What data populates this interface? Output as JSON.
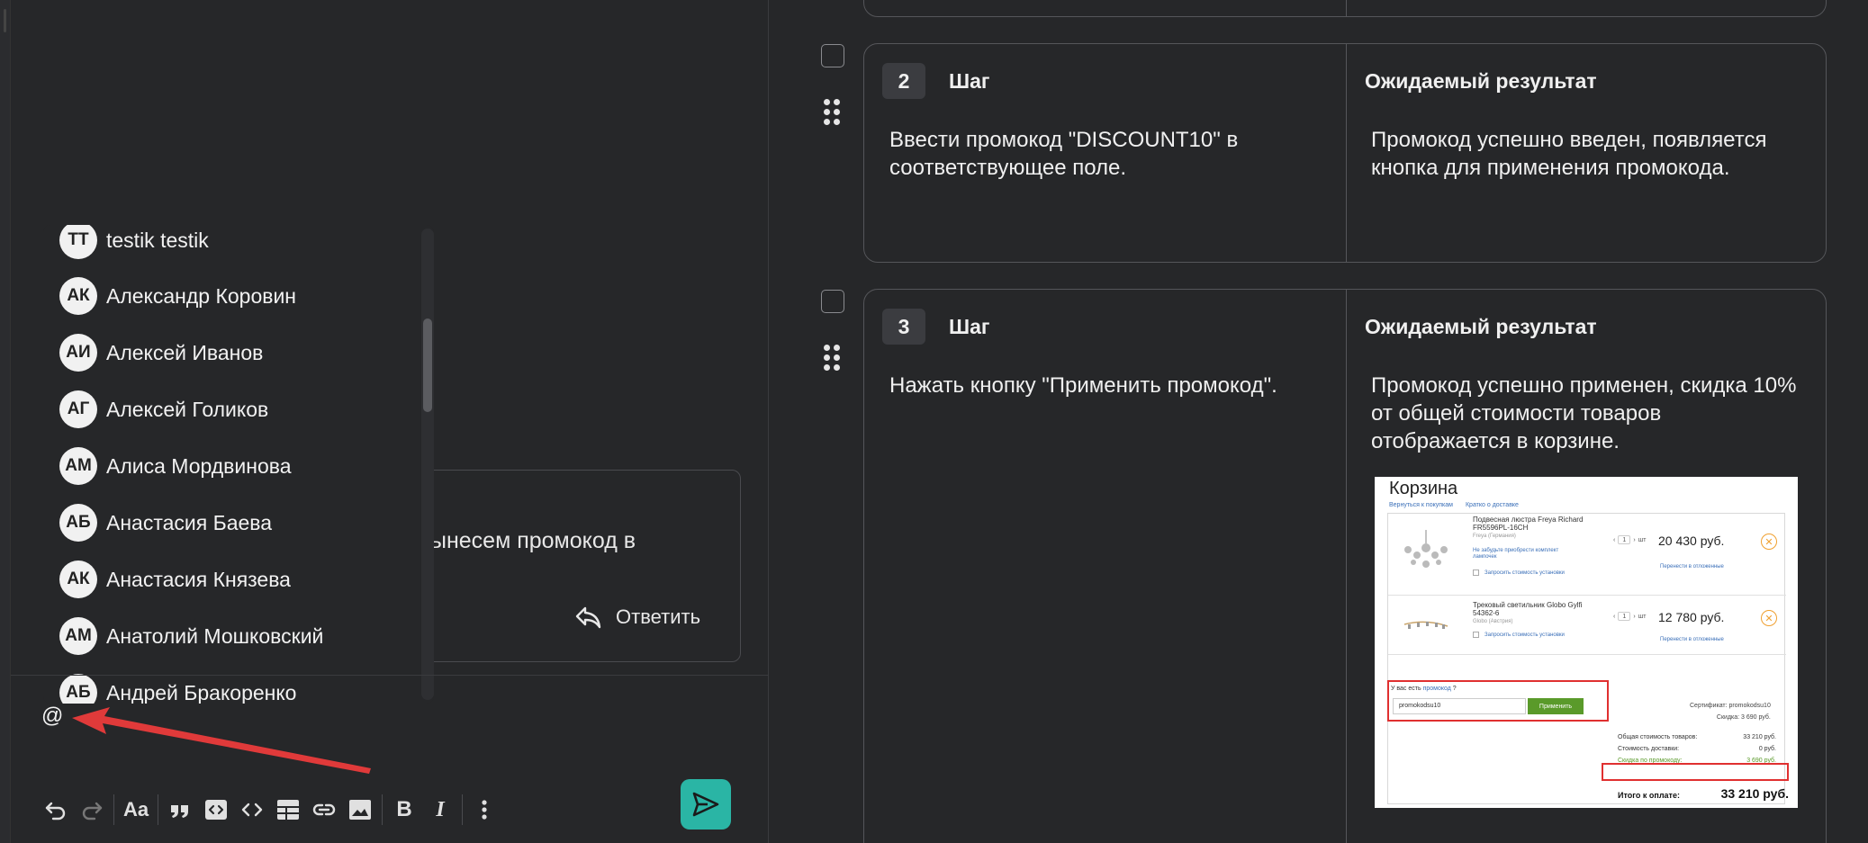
{
  "mentions": {
    "items": [
      {
        "initials": "TT",
        "name": "testik testik"
      },
      {
        "initials": "АК",
        "name": "Александр Коровин"
      },
      {
        "initials": "АИ",
        "name": "Алексей Иванов"
      },
      {
        "initials": "АГ",
        "name": "Алексей Голиков"
      },
      {
        "initials": "АМ",
        "name": "Алиса Мордвинова"
      },
      {
        "initials": "АБ",
        "name": "Анастасия Баева"
      },
      {
        "initials": "АК",
        "name": "Анастасия Князева"
      },
      {
        "initials": "АМ",
        "name": "Анатолий Мошковский"
      },
      {
        "initials": "АБ",
        "name": "Андрей Бракоренко"
      }
    ]
  },
  "message": {
    "text_fragment": "ынесем промокод в",
    "reply_label": "Ответить"
  },
  "composer": {
    "value": "@"
  },
  "toolbar": {
    "buttons": [
      "undo-icon",
      "redo-icon",
      "font-size-icon",
      "quote-icon",
      "code-block-icon",
      "inline-code-icon",
      "table-icon",
      "link-icon",
      "image-icon",
      "bold-icon",
      "italic-icon",
      "more-icon"
    ],
    "font_size_label": "Aa",
    "bold_label": "B",
    "italic_label": "I"
  },
  "steps": [
    {
      "number": "2",
      "step_label": "Шаг",
      "expected_label": "Ожидаемый результат",
      "step_text": "Ввести промокод \"DISCOUNT10\" в соответствующее поле.",
      "expected_text": "Промокод успешно введен, появляется кнопка для применения промокода."
    },
    {
      "number": "3",
      "step_label": "Шаг",
      "expected_label": "Ожидаемый результат",
      "step_text": "Нажать кнопку \"Применить промокод\".",
      "expected_text": "Промокод успешно применен, скидка 10% от общей стоимости товаров отображается в корзине."
    }
  ],
  "cart_screenshot": {
    "title": "Корзина",
    "links": [
      "Вернуться к покупкам",
      "Кратко о доставке"
    ],
    "products": [
      {
        "name": "Подвесная люстра Freya Richard FR5596PL-16CH",
        "brand": "Freya (Германия)",
        "hint": "Не забудьте приобрести комплект лампочек",
        "install": "Запросить стоимость установки",
        "qty": "1",
        "unit": "шт",
        "price": "20 430 руб.",
        "move": "Перенести в отложенные"
      },
      {
        "name": "Трековый светильник Globo Gylfi 54362-6",
        "brand": "Globo (Австрия)",
        "install": "Запросить стоимость установки",
        "qty": "1",
        "unit": "шт",
        "price": "12 780 руб.",
        "move": "Перенести в отложенные"
      }
    ],
    "promo_question": "У вас есть",
    "promo_link": "промокод",
    "promo_question_end": "?",
    "promo_value": "promokodsu10",
    "promo_apply": "Применить",
    "certificate": "Сертификат: promokodsu10",
    "discount_line": "Скидка: 3 690 руб.",
    "totals": [
      {
        "label": "Общая стоимость товаров:",
        "value": "33 210 руб."
      },
      {
        "label": "Стоимость доставки:",
        "value": "0 руб."
      },
      {
        "label": "Скидка по промокоду:",
        "value": "3 690 руб."
      }
    ],
    "grand_label": "Итого к оплате:",
    "grand_value": "33 210 руб."
  },
  "colors": {
    "background": "#262729",
    "accent_teal": "#2ab5a5",
    "arrow_red": "#e03a3a",
    "border": "#55565a"
  }
}
